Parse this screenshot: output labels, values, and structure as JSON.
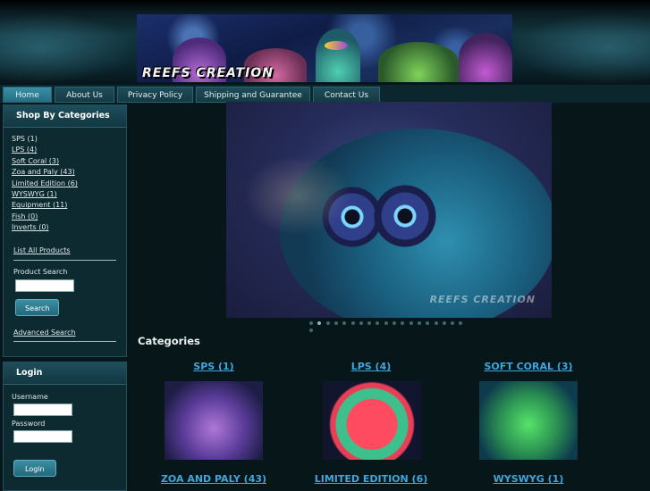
{
  "header": {
    "logo_text": "REEFS CREATION"
  },
  "nav": {
    "tabs": [
      "Home",
      "About Us",
      "Privacy Policy",
      "Shipping and Guarantee",
      "Contact Us"
    ]
  },
  "sidebar": {
    "categories_title": "Shop By Categories",
    "categories": [
      "SPS (1)",
      "LPS (4)",
      "Soft Coral (3)",
      "Zoa and Paly (43)",
      "Limited Edition (6)",
      "WYSWYG (1)",
      "Equipment (11)",
      "Fish (0)",
      "Inverts (0)"
    ],
    "list_all": "List All Products",
    "product_search_label": "Product Search",
    "search_button": "Search",
    "advanced_search": "Advanced Search",
    "login_title": "Login",
    "username_label": "Username",
    "password_label": "Password",
    "login_button": "Login"
  },
  "hero": {
    "watermark": "REEFS CREATION",
    "slide_count": 20,
    "active_slide": 2
  },
  "main": {
    "categories_heading": "Categories",
    "cards": [
      {
        "title": "SPS (1)"
      },
      {
        "title": "LPS (4)"
      },
      {
        "title": "SOFT CORAL (3)"
      },
      {
        "title": "ZOA AND PALY (43)"
      },
      {
        "title": "LIMITED EDITION (6)"
      },
      {
        "title": "WYSWYG (1)"
      }
    ]
  },
  "colors": {
    "page_bg": "#061619",
    "link_blue": "#3fa6dc",
    "active_tab": "#2f8098"
  }
}
